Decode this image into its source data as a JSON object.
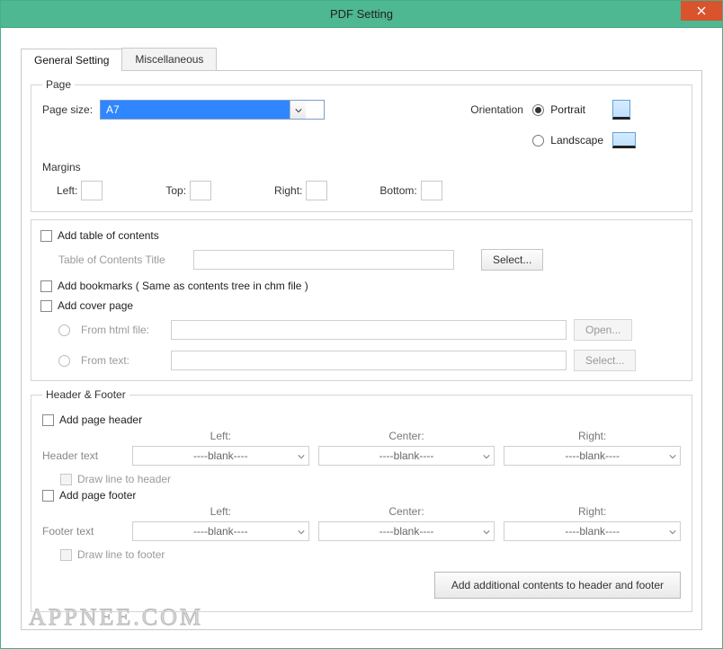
{
  "window": {
    "title": "PDF Setting"
  },
  "tabs": {
    "general": "General Setting",
    "misc": "Miscellaneous"
  },
  "page": {
    "legend": "Page",
    "size_label": "Page size:",
    "size_value": "A7",
    "orientation_label": "Orientation",
    "portrait": "Portrait",
    "landscape": "Landscape",
    "margins_label": "Margins",
    "left": "Left:",
    "top": "Top:",
    "right": "Right:",
    "bottom": "Bottom:"
  },
  "toc": {
    "add_toc": "Add table of contents",
    "title_label": "Table of Contents Title",
    "select": "Select...",
    "add_bookmarks": "Add  bookmarks ( Same as contents tree in chm file )",
    "add_cover": "Add cover page",
    "from_html": "From html file:",
    "from_text": "From  text:",
    "open": "Open...",
    "select2": "Select..."
  },
  "hf": {
    "legend": "Header & Footer",
    "add_header": "Add page header",
    "header_text": "Header text",
    "draw_line_header": "Draw line to header",
    "add_footer": "Add page footer",
    "footer_text": "Footer text",
    "draw_line_footer": "Draw line to footer",
    "col_left": "Left:",
    "col_center": "Center:",
    "col_right": "Right:",
    "blank": "----blank----",
    "add_additional": "Add additional contents to header and footer"
  },
  "watermark": "APPNEE.COM"
}
